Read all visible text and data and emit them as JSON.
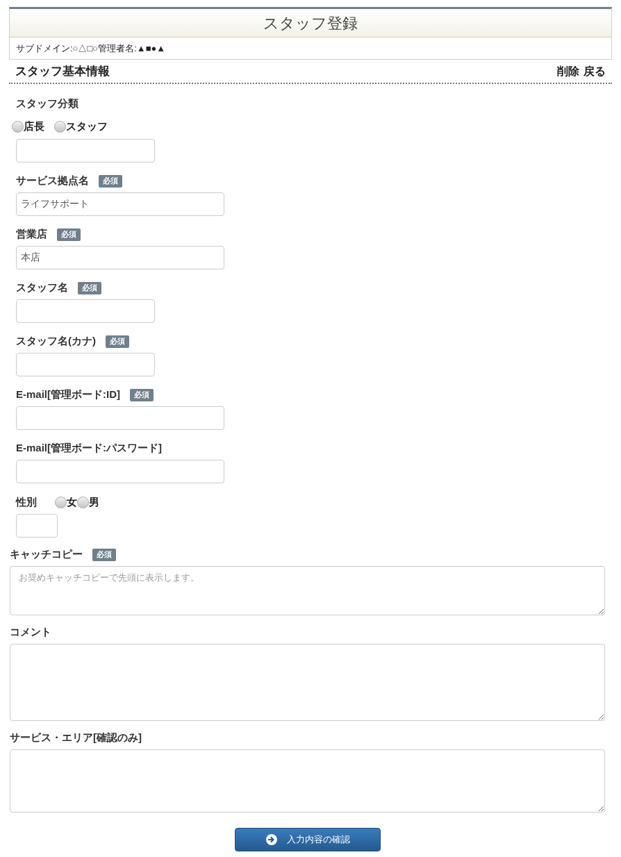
{
  "header": {
    "title": "スタッフ登録",
    "info": "サブドメイン:○△□○管理者名:▲■●▲"
  },
  "section": {
    "title": "スタッフ基本情報",
    "actions": [
      "削除",
      "戻る"
    ]
  },
  "fields": [
    {
      "kind": "radio",
      "label": "スタッフ分類",
      "options": [
        {
          "label": "店長",
          "selected": false
        },
        {
          "label": "スタッフ",
          "selected": false
        }
      ]
    },
    {
      "kind": "text",
      "label": "サービス拠点名",
      "badge": "必須",
      "value": "ライフサポート"
    },
    {
      "kind": "text",
      "label": "営業店",
      "badge": "必須",
      "value": "本店"
    },
    {
      "kind": "short-text",
      "label": "スタッフ名",
      "badge": "必須"
    },
    {
      "kind": "short-text",
      "label": "スタッフ名(カナ)",
      "badge": "必須"
    },
    {
      "kind": "text",
      "label": "E-mail[管理ボード:ID]",
      "badge": "必須"
    },
    {
      "kind": "text",
      "label": "E-mail[管理ボード:パスワード]"
    },
    {
      "kind": "inline-radio",
      "label": "性別",
      "options": [
        {
          "label": "女",
          "selected": false
        },
        {
          "label": "男",
          "selected": false
        }
      ]
    },
    {
      "kind": "short-textarea",
      "label": "キャッチコピー",
      "badge": "必須",
      "placeholder": "お奨めキャッチコピーで先頭に表示します。"
    },
    {
      "kind": "tall-textarea",
      "label": "コメント"
    },
    {
      "kind": "textarea",
      "label": "サービス・エリア[確認のみ]"
    }
  ],
  "submit": {
    "label": "入力内容の確認"
  }
}
